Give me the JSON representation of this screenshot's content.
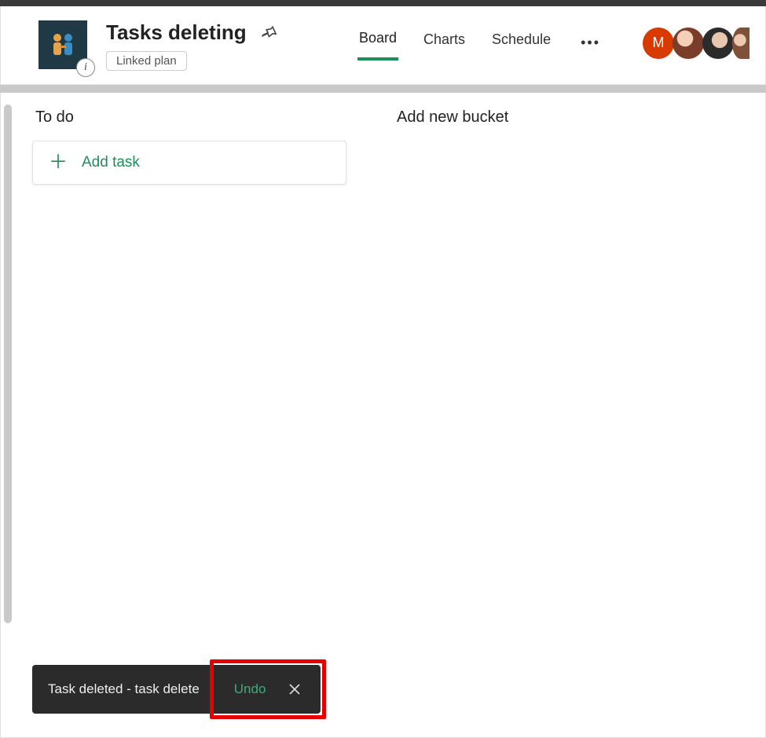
{
  "header": {
    "plan_title": "Tasks deleting",
    "linked_plan_label": "Linked plan",
    "info_badge_glyph": "i",
    "tabs": [
      {
        "label": "Board",
        "active": true
      },
      {
        "label": "Charts",
        "active": false
      },
      {
        "label": "Schedule",
        "active": false
      }
    ],
    "avatars": {
      "letter": "M"
    }
  },
  "board": {
    "bucket_title": "To do",
    "add_task_label": "Add task",
    "new_bucket_label": "Add new bucket"
  },
  "toast": {
    "message": "Task deleted - task delete",
    "undo_label": "Undo"
  }
}
